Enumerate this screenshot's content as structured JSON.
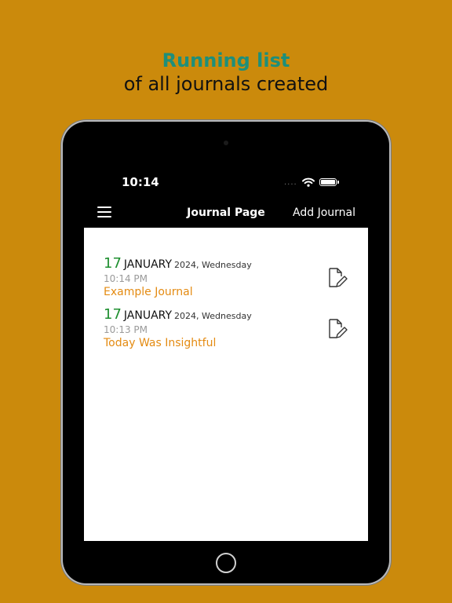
{
  "promo": {
    "headline_accent": "Running list",
    "headline_text": "of all journals created"
  },
  "status": {
    "time": "10:14",
    "signal_dots": "....",
    "wifi_icon": "wifi-icon",
    "battery_icon": "battery-icon"
  },
  "navbar": {
    "title": "Journal Page",
    "action_label": "Add Journal",
    "menu_icon": "hamburger-menu-icon"
  },
  "journals": [
    {
      "day": "17",
      "month": "JANUARY",
      "rest": "2024, Wednesday",
      "time": "10:14 PM",
      "title": "Example Journal",
      "edit_icon": "edit-document-icon"
    },
    {
      "day": "17",
      "month": "JANUARY",
      "rest": "2024, Wednesday",
      "time": "10:13 PM",
      "title": "Today Was Insightful",
      "edit_icon": "edit-document-icon"
    }
  ],
  "colors": {
    "background": "#CB8A0C",
    "accent_teal": "#1E8F7A",
    "day_green": "#1E8F2F",
    "title_orange": "#E48B12"
  }
}
